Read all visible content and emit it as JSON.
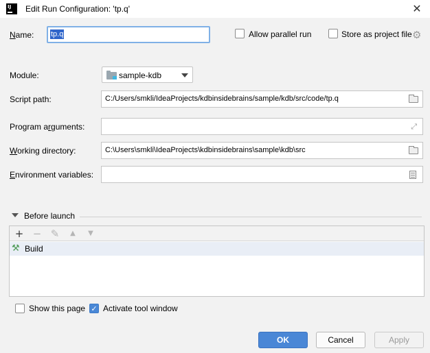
{
  "window": {
    "title": "Edit Run Configuration: 'tp.q'",
    "app_icon_text": "IJ",
    "close_glyph": "✕"
  },
  "form": {
    "name_label_u": "N",
    "name_label_rest": "ame:",
    "name_value": "tp.q",
    "allow_parallel_label": "Allow parallel run",
    "store_project_label": "Store as project file",
    "module_label": "Module:",
    "module_value": "sample-kdb",
    "script_path_label": "Script path:",
    "script_path_value": "C:/Users/smkli/IdeaProjects/kdbinsidebrains/sample/kdb/src/code/tp.q",
    "program_args_label": "Program arguments:",
    "program_args_value": "",
    "working_dir_label": "Working directory:",
    "working_dir_value": "C:\\Users\\smkli\\IdeaProjects\\kdbinsidebrains\\sample\\kdb\\src",
    "env_vars_label": "Environment variables:",
    "env_vars_value": ""
  },
  "before_launch": {
    "title": "Before launch",
    "toolbar": {
      "add": "+",
      "remove": "−",
      "edit": "✎",
      "up": "▲",
      "down": "▼"
    },
    "items": [
      {
        "label": "Build",
        "icon": "hammer-icon"
      }
    ]
  },
  "options": {
    "show_page_label": "Show this page",
    "show_page_checked": false,
    "activate_tool_label": "Activate tool window",
    "activate_tool_checked": true
  },
  "buttons": {
    "ok": "OK",
    "cancel": "Cancel",
    "apply": "Apply"
  },
  "colors": {
    "accent": "#4a87d6",
    "selection": "#2f65ca",
    "build_icon": "#4e9a55"
  }
}
